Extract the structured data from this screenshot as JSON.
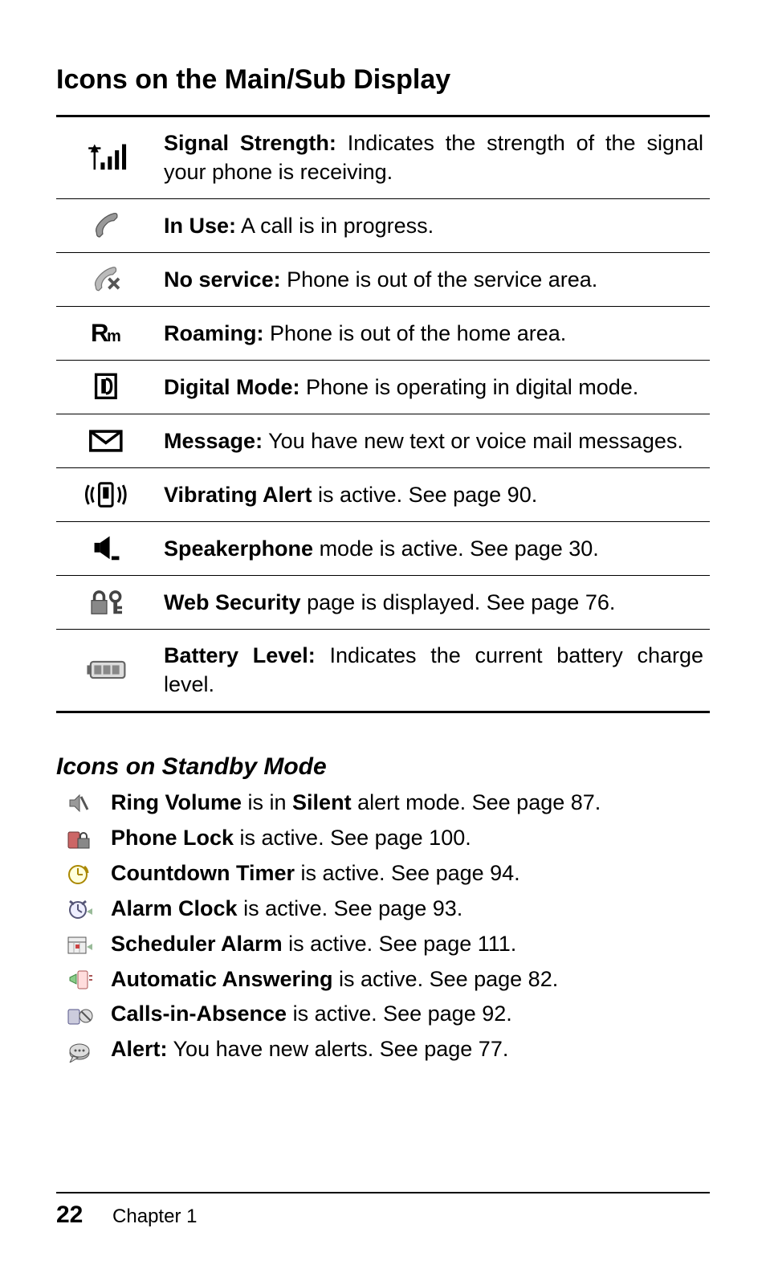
{
  "title": "Icons on the Main/Sub Display",
  "table": [
    {
      "icon": "signal",
      "bold": "Signal Strength:",
      "rest": "  Indicates the strength of the signal your phone is receiving."
    },
    {
      "icon": "inuse",
      "bold": "In Use:",
      "rest": " A call is in progress."
    },
    {
      "icon": "noservice",
      "bold": "No service:",
      "rest": " Phone is out of the service area."
    },
    {
      "icon": "roaming",
      "bold": "Roaming:",
      "rest": " Phone is out of the home area."
    },
    {
      "icon": "digital",
      "bold": "Digital Mode:",
      "rest": " Phone is operating in digital mode."
    },
    {
      "icon": "message",
      "bold": "Message:",
      "rest": " You have new text or voice mail messages."
    },
    {
      "icon": "vibrate",
      "bold": "Vibrating Alert",
      "rest": " is active. See page 90."
    },
    {
      "icon": "speaker",
      "bold": "Speakerphone",
      "rest": " mode is active. See page 30."
    },
    {
      "icon": "websec",
      "bold": "Web Security",
      "rest": " page is displayed. See page 76."
    },
    {
      "icon": "battery",
      "bold": "Battery Level:",
      "rest": " Indicates the current battery charge level."
    }
  ],
  "subtitle": "Icons on Standby Mode",
  "standby": [
    {
      "icon": "ringvol",
      "bold1": "Ring Volume",
      "mid": " is in ",
      "bold2": "Silent",
      "rest": " alert mode. See page 87."
    },
    {
      "icon": "phonelock",
      "bold1": "Phone Lock",
      "rest": " is active. See page 100."
    },
    {
      "icon": "timer",
      "bold1": "Countdown Timer",
      "rest": " is active. See page 94."
    },
    {
      "icon": "alarm",
      "bold1": "Alarm Clock",
      "rest": " is active. See page 93."
    },
    {
      "icon": "scheduler",
      "bold1": "Scheduler Alarm",
      "rest": " is active. See page 111."
    },
    {
      "icon": "autoans",
      "bold1": "Automatic Answering",
      "rest": " is active. See page 82."
    },
    {
      "icon": "absence",
      "bold1": "Calls-in-Absence",
      "rest": " is active. See page 92."
    },
    {
      "icon": "alert",
      "bold1": "Alert:",
      "rest": " You have new alerts. See page 77."
    }
  ],
  "footer": {
    "page": "22",
    "chapter": "Chapter 1"
  }
}
